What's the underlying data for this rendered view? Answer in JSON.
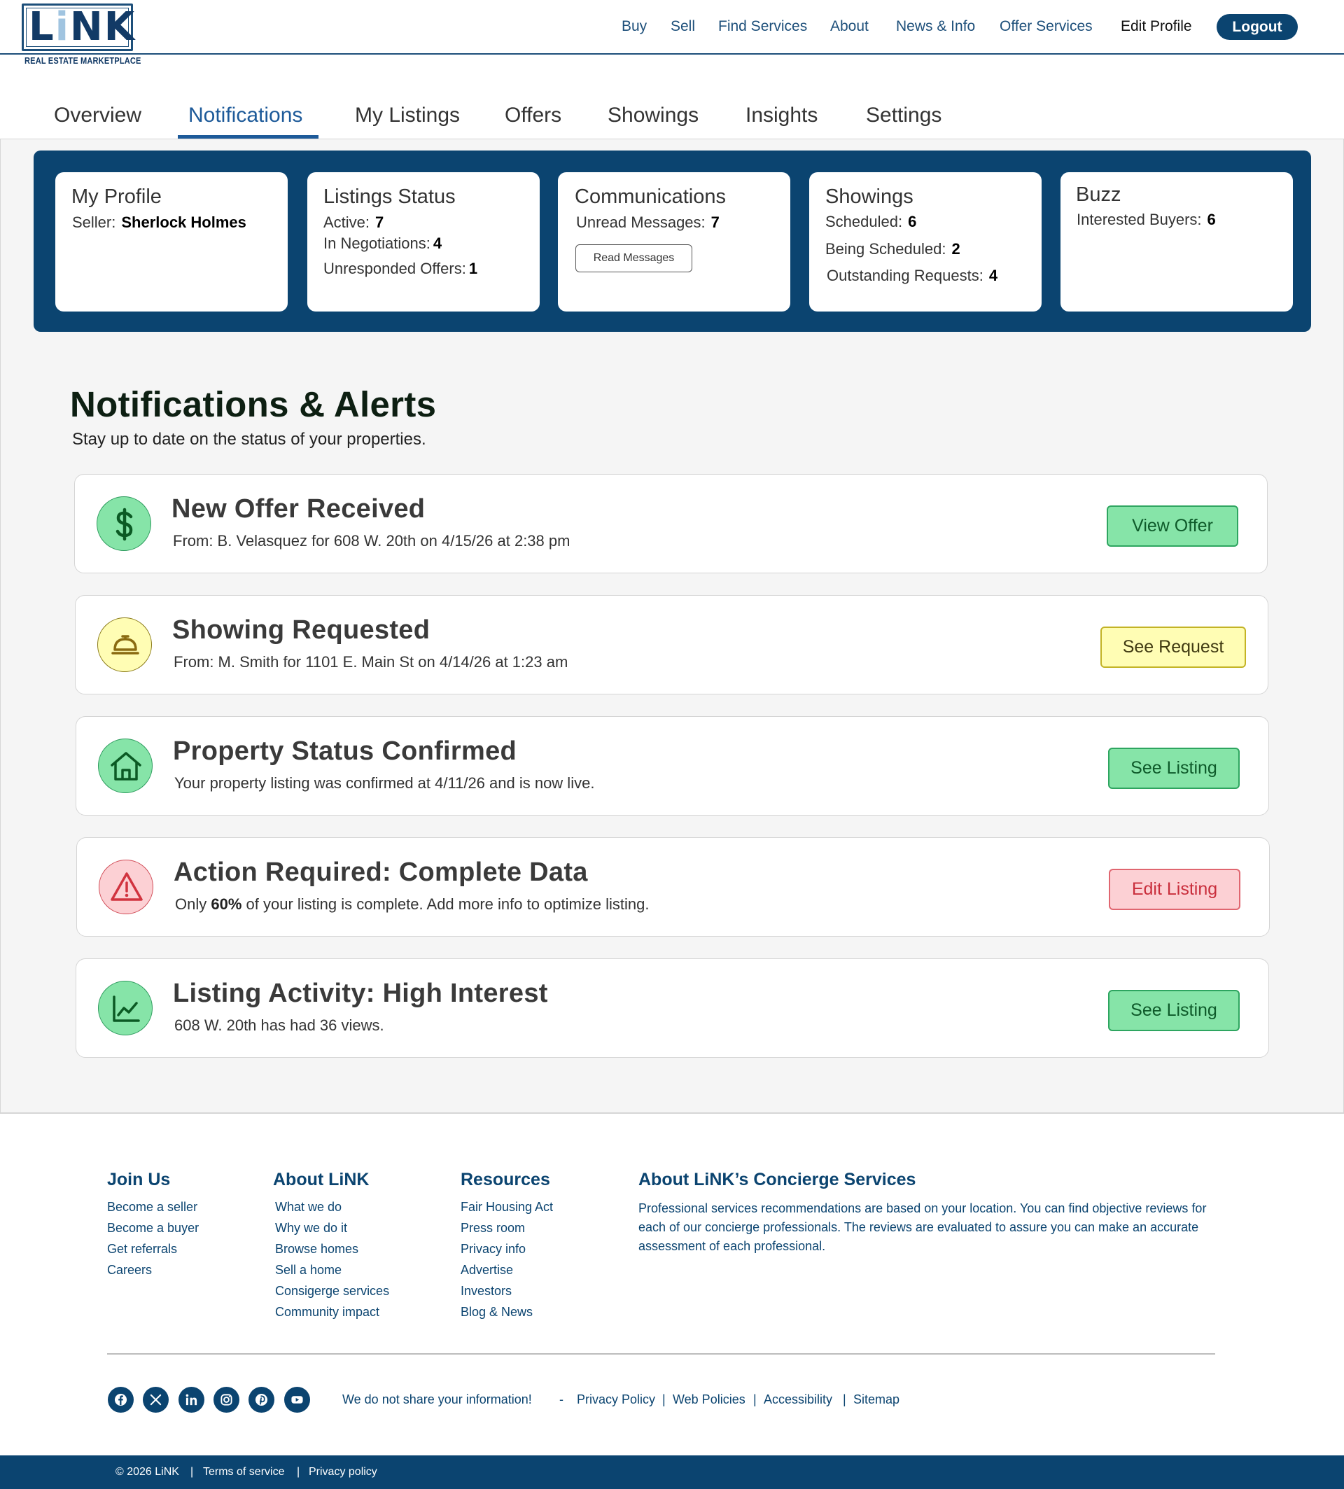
{
  "brand": {
    "logo_word_a": "L",
    "logo_word_i": "i",
    "logo_word_b": "NK",
    "tagline": "REAL ESTATE MARKETPLACE",
    "primary_color": "#0b4470",
    "accent_color": "#1d5a99"
  },
  "nav": {
    "items": [
      "Buy",
      "Sell",
      "Find Services",
      "About",
      "News & Info",
      "Offer Services"
    ],
    "edit_profile": "Edit Profile",
    "logout": "Logout"
  },
  "tabs": {
    "items": [
      "Overview",
      "Notifications",
      "My Listings",
      "Offers",
      "Showings",
      "Insights",
      "Settings"
    ],
    "active": "Notifications"
  },
  "summary": {
    "profile": {
      "title": "My Profile",
      "label": "Seller:",
      "value": "Sherlock Holmes"
    },
    "listings": {
      "title": "Listings Status",
      "active_label": "Active:",
      "active_value": "7",
      "neg_label": "In Negotiations:",
      "neg_value": "4",
      "offers_label": "Unresponded Offers:",
      "offers_value": "1"
    },
    "communications": {
      "title": "Communications",
      "unread_label": "Unread Messages:",
      "unread_value": "7",
      "button": "Read Messages"
    },
    "showings": {
      "title": "Showings",
      "scheduled_label": "Scheduled:",
      "scheduled_value": "6",
      "being_label": "Being Scheduled:",
      "being_value": "2",
      "outstanding_label": "Outstanding Requests:",
      "outstanding_value": "4"
    },
    "buzz": {
      "title": "Buzz",
      "label": "Interested Buyers:",
      "value": "6"
    }
  },
  "notifications": {
    "title": "Notifications & Alerts",
    "subtitle": "Stay up to date on the status of your properties.",
    "items": [
      {
        "icon": "dollar-icon",
        "color": "green",
        "title": "New Offer Received",
        "desc": "From: B. Velasquez for 608 W. 20th on 4/15/26 at 2:38 pm",
        "button": "View Offer"
      },
      {
        "icon": "service-bell-icon",
        "color": "yellow",
        "title": "Showing Requested",
        "desc": "From: M. Smith for 1101 E. Main St on 4/14/26 at 1:23 am",
        "button": "See Request"
      },
      {
        "icon": "house-icon",
        "color": "green",
        "title": "Property Status Confirmed",
        "desc": "Your property listing was confirmed at 4/11/26 and is now live.",
        "button": "See Listing"
      },
      {
        "icon": "warning-icon",
        "color": "red",
        "title": "Action Required: Complete Data",
        "desc_pre": "Only ",
        "desc_bold": "60%",
        "desc_post": " of your listing is complete. Add more info to optimize listing.",
        "button": "Edit Listing"
      },
      {
        "icon": "line-chart-icon",
        "color": "green",
        "title": "Listing Activity: High Interest",
        "desc": "608 W. 20th has had 36 views.",
        "button": "See Listing"
      }
    ]
  },
  "footer": {
    "join": {
      "title": "Join Us",
      "links": [
        "Become a seller",
        "Become a buyer",
        "Get referrals",
        "Careers"
      ]
    },
    "about": {
      "title": "About LiNK",
      "links": [
        "What we do",
        "Why we do it",
        "Browse homes",
        "Sell a home",
        "Consigerge services",
        "Community impact"
      ]
    },
    "resources": {
      "title": "Resources",
      "links": [
        "Fair Housing Act",
        "Press room",
        "Privacy info",
        "Advertise",
        "Investors",
        "Blog & News"
      ]
    },
    "concierge": {
      "title": "About LiNK’s Concierge Services",
      "text": "Professional services recommendations are based on your location. You can find objective reviews for each of our concierge professionals. The reviews are evaluated to assure you can make an accurate assessment of each professional."
    },
    "social": [
      "facebook-icon",
      "x-icon",
      "linkedin-icon",
      "instagram-icon",
      "pinterest-icon",
      "youtube-icon"
    ],
    "legal": {
      "notice": "We do not share your information!",
      "dash": "-",
      "links": [
        "Privacy Policy",
        "Web Policies",
        "Accessibility",
        "Sitemap"
      ],
      "sep": "|"
    },
    "bottom": {
      "copyright": "© 2026 LiNK",
      "terms": "Terms of service",
      "privacy": "Privacy policy",
      "sep": "|"
    }
  }
}
